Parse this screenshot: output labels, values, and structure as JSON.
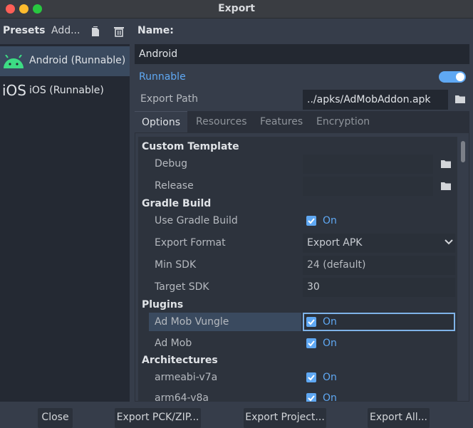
{
  "window": {
    "title": "Export"
  },
  "presets": {
    "label": "Presets",
    "add_label": "Add...",
    "items": [
      {
        "label": "Android (Runnable)",
        "icon": "android-icon",
        "selected": true
      },
      {
        "label": "iOS (Runnable)",
        "icon": "ios-text-icon",
        "icon_text": "iOS",
        "selected": false
      }
    ]
  },
  "preset": {
    "name_label": "Name:",
    "name_value": "Android",
    "runnable_label": "Runnable",
    "runnable_on": true,
    "export_path_label": "Export Path",
    "export_path_value": "../apks/AdMobAddon.apk"
  },
  "tabs": [
    "Options",
    "Resources",
    "Features",
    "Encryption"
  ],
  "options": {
    "custom_template": {
      "heading": "Custom Template",
      "debug_label": "Debug",
      "release_label": "Release"
    },
    "gradle_build": {
      "heading": "Gradle Build",
      "use_gradle_label": "Use Gradle Build",
      "use_gradle_value": "On",
      "export_format_label": "Export Format",
      "export_format_value": "Export APK",
      "min_sdk_label": "Min SDK",
      "min_sdk_value": "24 (default)",
      "target_sdk_label": "Target SDK",
      "target_sdk_value": "30"
    },
    "plugins": {
      "heading": "Plugins",
      "ad_mob_vungle_label": "Ad Mob Vungle",
      "ad_mob_vungle_value": "On",
      "ad_mob_label": "Ad Mob",
      "ad_mob_value": "On"
    },
    "architectures": {
      "heading": "Architectures",
      "armeabi_label": "armeabi-v7a",
      "armeabi_value": "On",
      "arm64_label": "arm64-v8a",
      "arm64_value": "On"
    }
  },
  "buttons": {
    "close": "Close",
    "export_pck": "Export PCK/ZIP...",
    "export_project": "Export Project...",
    "export_all": "Export All..."
  },
  "colors": {
    "accent": "#5fa8f3",
    "background": "#363d4a",
    "field": "#232831"
  }
}
